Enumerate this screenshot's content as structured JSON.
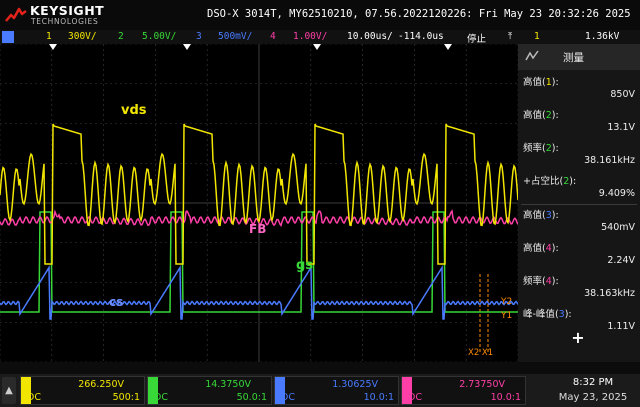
{
  "brand": {
    "name": "KEYSIGHT",
    "sub": "TECHNOLOGIES"
  },
  "title": "DSO-X 3014T, MY62510210, 07.56.2022120226: Fri May 23 20:32:26 2025",
  "channel_bar": {
    "ch1": {
      "num": "1",
      "scale": "300V/",
      "color": "#f2e600"
    },
    "ch2": {
      "num": "2",
      "scale": "5.00V/",
      "color": "#37d837"
    },
    "ch3": {
      "num": "3",
      "scale": "500mV/",
      "color": "#4a7bff"
    },
    "ch4": {
      "num": "4",
      "scale": "1.00V/",
      "color": "#ff3fa8"
    },
    "timebase": "10.00us/",
    "delay": "-114.0us",
    "run_state": "停止",
    "trigger_ch": "1",
    "trigger_level": "1.36kV"
  },
  "waveform_labels": {
    "vds": "vds",
    "fb": "FB",
    "gs": "gs",
    "cs": "cs"
  },
  "markers": {
    "y1": "Y1",
    "y2": "Y2",
    "x2x1": "X2 X1"
  },
  "measure_panel": {
    "title": "测量",
    "items": [
      {
        "label": "高值",
        "ch": "1",
        "value": "850V"
      },
      {
        "label": "高值",
        "ch": "2",
        "value": "13.1V"
      },
      {
        "label": "频率",
        "ch": "2",
        "value": "38.161kHz"
      },
      {
        "label": "+占空比",
        "ch": "2",
        "value": "9.409%"
      },
      {
        "label": "高值",
        "ch": "3",
        "value": "540mV"
      },
      {
        "label": "高值",
        "ch": "4",
        "value": "2.24V"
      },
      {
        "label": "频率",
        "ch": "4",
        "value": "38.163kHz"
      },
      {
        "label": "峰-峰值",
        "ch": "3",
        "value": "1.11V"
      }
    ],
    "add_label": "+"
  },
  "bottom": {
    "ch1": {
      "value": "266.250V",
      "coupling": "DC",
      "ratio": "500:1",
      "color": "#f2e600"
    },
    "ch2": {
      "value": "14.3750V",
      "coupling": "DC",
      "ratio": "50.0:1",
      "color": "#37d837"
    },
    "ch3": {
      "value": "1.30625V",
      "coupling": "DC",
      "ratio": "10.0:1",
      "color": "#4a7bff"
    },
    "ch4": {
      "value": "2.73750V",
      "coupling": "DC",
      "ratio": "10.0:1",
      "color": "#ff3fa8"
    },
    "time": "8:32 PM",
    "date": "May 23, 2025",
    "up_glyph": "▲"
  },
  "colors": {
    "ch1": "#f2e600",
    "ch2": "#37d837",
    "ch3": "#4a7bff",
    "ch4": "#ff3fa8",
    "grid": "#3c3c3c",
    "accent_orange": "#ff8c00"
  }
}
